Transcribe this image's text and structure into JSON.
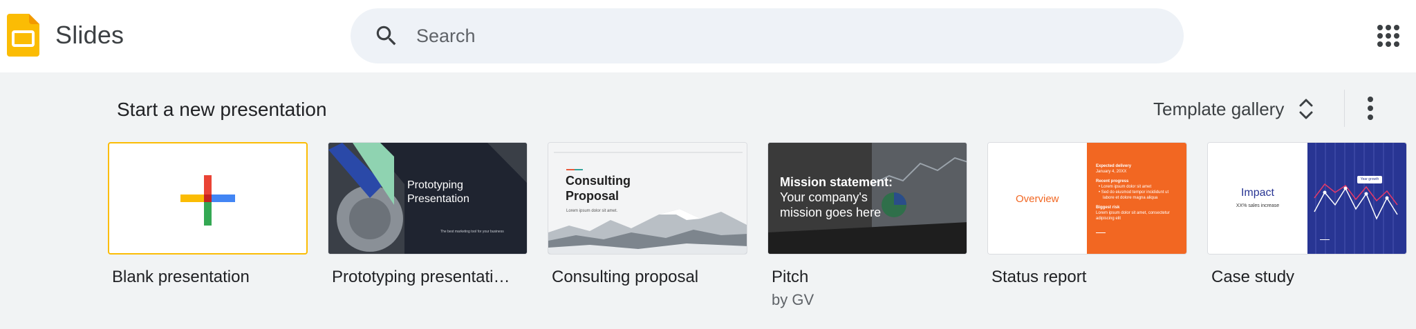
{
  "app": {
    "name": "Slides"
  },
  "search": {
    "placeholder": "Search",
    "value": ""
  },
  "icons": {
    "logo": "slides-logo",
    "search": "search-icon",
    "apps": "apps-grid-icon",
    "more": "more-vert-icon",
    "unfold": "unfold-more-icon"
  },
  "colors": {
    "logo_yellow": "#fbbc04",
    "search_bg": "#eef2f7",
    "page_bg": "#f1f3f4",
    "accent_orange": "#f26722",
    "navy": "#283593"
  },
  "section": {
    "title": "Start a new presentation",
    "gallery_label": "Template gallery"
  },
  "templates": [
    {
      "title": "Blank presentation",
      "subtitle": ""
    },
    {
      "title": "Prototyping presentati…",
      "subtitle": "",
      "thumb": {
        "line1": "Prototyping",
        "line2": "Presentation",
        "tagline": "The best marketing tool for your business"
      }
    },
    {
      "title": "Consulting proposal",
      "subtitle": "",
      "thumb": {
        "line1": "Consulting",
        "line2": "Proposal",
        "body": "Lorem ipsum dolor sit amet."
      }
    },
    {
      "title": "Pitch",
      "subtitle": "by GV",
      "thumb": {
        "heading": "Mission statement:",
        "line2": "Your company's",
        "line3": "mission goes here"
      }
    },
    {
      "title": "Status report",
      "subtitle": "",
      "thumb": {
        "overview": "Overview",
        "h1": "Expected delivery",
        "d1": "January 4, 20XX",
        "h2": "Recent progress",
        "b1": "Lorem ipsum dolor sit amet",
        "b2": "Sed do eiusmod tempor incididunt ut",
        "b2b": "labore et dolore magna aliqua",
        "h3": "Biggest risk",
        "r1": "Lorem ipsum dolor sit amet, consectetur",
        "r2": "adipiscing elit"
      }
    },
    {
      "title": "Case study",
      "subtitle": "",
      "thumb": {
        "heading": "Impact",
        "sub": "XX% sales increase",
        "tooltip": "Year growth"
      }
    }
  ]
}
